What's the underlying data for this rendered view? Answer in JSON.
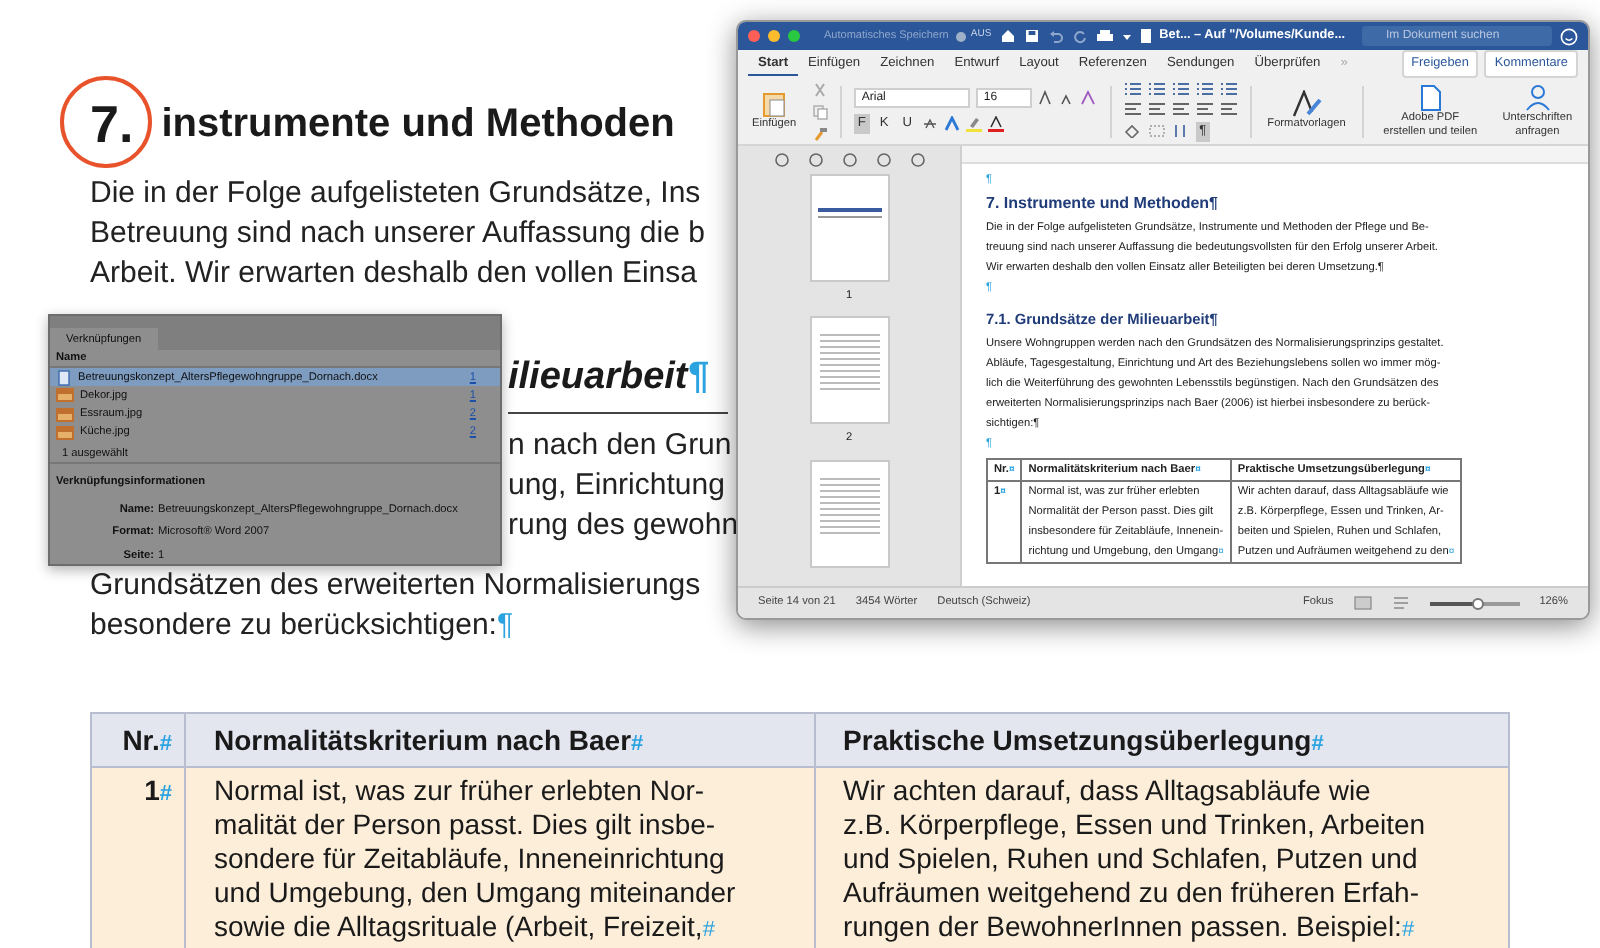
{
  "document": {
    "heading": {
      "number": "7.",
      "title": "instrumente und Methoden"
    },
    "intro_lines": [
      "Die in der Folge aufgelisteten Grundsätze, Ins",
      "Betreuung sind nach unserer Auffassung die b",
      "Arbeit. Wir erwarten deshalb den vollen Einsa"
    ],
    "subheading": "ilieuarbeit",
    "para_mark": "¶",
    "side_lines": [
      "n nach den Grun",
      "ung, Einrichtung",
      "rung des gewohn"
    ],
    "lines": [
      "Grundsätzen des erweiterten Normalisierungs",
      "besondere zu berücksichtigen:"
    ],
    "table": {
      "cell_mark": "#",
      "columns": [
        "Nr.",
        "Normalitätskriterium nach Baer",
        "Praktische Umsetzungsüberlegung"
      ],
      "rows": [
        {
          "cells": [
            [
              "1"
            ],
            [
              "Normal ist, was zur früher erlebten Nor-",
              "malität der Person passt. Dies gilt insbe-",
              "sondere für Zeitabläufe, Inneneinrichtung",
              "und Umgebung, den Umgang miteinander",
              "sowie die Alltagsrituale (Arbeit, Freizeit,"
            ],
            [
              "Wir achten darauf, dass Alltagsabläufe wie",
              "z.B. Körperpflege, Essen und Trinken, Arbeiten",
              "und Spielen, Ruhen und Schlafen, Putzen und",
              "Aufräumen weitgehend zu den früheren Erfah-",
              "rungen der BewohnerInnen passen. Beispiel:"
            ]
          ]
        }
      ]
    }
  },
  "links_panel": {
    "title": "Verknüpfungen",
    "name_header": "Name",
    "rows": [
      {
        "kind": "document",
        "name": "Betreuungskonzept_AltersPflegewohngruppe_Dornach.docx",
        "page": "1",
        "selected": true
      },
      {
        "kind": "image",
        "name": "Dekor.jpg",
        "page": "1",
        "selected": false
      },
      {
        "kind": "image",
        "name": "Essraum.jpg",
        "page": "2",
        "selected": false
      },
      {
        "kind": "image",
        "name": "Küche.jpg",
        "page": "2",
        "selected": false
      }
    ],
    "selection": "1 ausgewählt",
    "info_title": "Verknüpfungsinformationen",
    "info": [
      {
        "label": "Name:",
        "value": "Betreuungskonzept_AltersPflegewohngruppe_Dornach.docx"
      },
      {
        "label": "Format:",
        "value": "Microsoft® Word 2007"
      },
      {
        "label": "Seite:",
        "value": "1"
      }
    ]
  },
  "word_window": {
    "autosave_label": "Automatisches Speichern",
    "autosave": {
      "label": "AUS",
      "on": false
    },
    "title": "Bet... – Auf \"/Volumes/Kunde...",
    "search": {
      "placeholder": "Im Dokument suchen"
    },
    "tabs": [
      {
        "label": "Start",
        "selected": true
      },
      {
        "label": "Einfügen",
        "selected": false
      },
      {
        "label": "Zeichnen",
        "selected": false
      },
      {
        "label": "Entwurf",
        "selected": false
      },
      {
        "label": "Layout",
        "selected": false
      },
      {
        "label": "Referenzen",
        "selected": false
      },
      {
        "label": "Sendungen",
        "selected": false
      },
      {
        "label": "Überprüfen",
        "selected": false
      }
    ],
    "more_tabs": "»",
    "share_button": "Freigeben",
    "comments_button": "Kommentare",
    "paste_label": "Einfügen",
    "font": "Arial",
    "font_size": "16",
    "format_buttons": [
      {
        "label": "F",
        "selected": true
      },
      {
        "label": "K",
        "selected": false
      },
      {
        "label": "U",
        "selected": false
      }
    ],
    "show_marks": {
      "label": "¶",
      "on": true
    },
    "styles_label": "Formatvorlagen",
    "pdf_label": "Adobe PDF erstellen und teilen",
    "sign_label": "Unterschriften anfragen",
    "thumbnails": [
      {
        "kind": "title",
        "label": "1"
      },
      {
        "kind": "toc",
        "label": "2"
      },
      {
        "kind": "toc"
      }
    ],
    "page": {
      "mark": "¶",
      "heading": "7. Instrumente und Methoden¶",
      "para1": [
        "Die in der Folge aufgelisteten Grundsätze, Instrumente und Methoden der Pflege und Be-",
        "treuung sind nach unserer Auffassung die bedeutungsvollsten für den Erfolg unserer Arbeit.",
        "Wir erwarten deshalb den vollen Einsatz aller Beteiligten bei deren Umsetzung.¶"
      ],
      "heading2": "7.1. Grundsätze der Milieuarbeit¶",
      "para2": [
        "Unsere Wohngruppen werden nach den Grundsätzen des Normalisierungsprinzips gestaltet.",
        "Abläufe, Tagesgestaltung, Einrichtung und Art des Beziehungslebens sollen wo immer mög-",
        "lich die Weiterführung des gewohnten Lebensstils begünstigen. Nach den Grundsätzen des",
        "erweiterten Normalisierungsprinzips nach Baer (2006) ist hierbei insbesondere zu berück-",
        "sichtigen:¶"
      ],
      "table": {
        "cell_mark": "¤",
        "columns": [
          "Nr.",
          "Normalitätskriterium nach Baer",
          "Praktische Umsetzungsüberlegung"
        ],
        "rows": [
          {
            "cells": [
              [
                "1"
              ],
              [
                "Normal ist, was zur früher erlebten",
                "Normalität der Person passt. Dies gilt",
                "insbesondere für Zeitabläufe, Innenein-",
                "richtung und Umgebung, den Umgang"
              ],
              [
                "Wir achten darauf, dass Alltagsabläufe wie",
                "z.B. Körperpflege, Essen und Trinken, Ar-",
                "beiten und Spielen, Ruhen und Schlafen,",
                "Putzen und Aufräumen weitgehend zu den"
              ]
            ]
          }
        ]
      }
    },
    "status": {
      "page": "Seite 14 von 21",
      "words": "3454 Wörter",
      "language": "Deutsch (Schweiz)",
      "focus": "Fokus",
      "zoom": {
        "level": 0.55
      },
      "zoom_label": "126%"
    }
  }
}
